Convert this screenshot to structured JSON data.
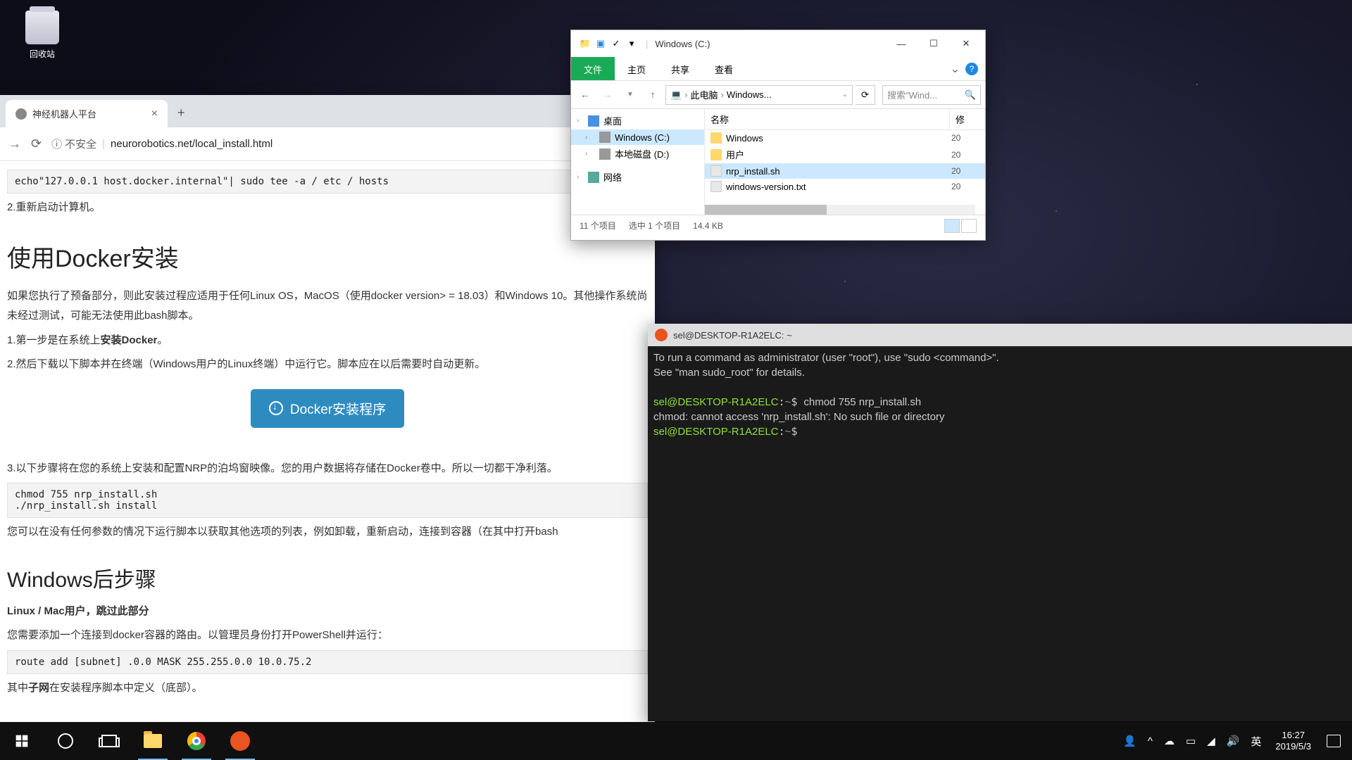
{
  "desktop": {
    "recycle_bin": "回收站"
  },
  "browser": {
    "tab_title": "神经机器人平台",
    "insecure": "不安全",
    "url": "neurorobotics.net/local_install.html",
    "code1": "echo\"127.0.0.1 host.docker.internal\"| sudo tee -a / etc / hosts",
    "step2": "2.重新启动计算机。",
    "h1": "使用Docker安装",
    "p1": "如果您执行了预备部分，则此安装过程应适用于任何Linux OS，MacOS（使用docker version> = 18.03）和Windows 10。其他操作系统尚未经过测试，可能无法使用此bash脚本。",
    "li1a": "1.第一步是在系统上",
    "li1b": "安装Docker",
    "li1c": "。",
    "li2": "2.然后下载以下脚本并在终端（Windows用户的Linux终端）中运行它。脚本应在以后需要时自动更新。",
    "docker_btn": "Docker安装程序",
    "li3": "3.以下步骤将在您的系统上安装和配置NRP的泊坞窗映像。您的用户数据将存储在Docker卷中。所以一切都干净利落。",
    "code2": "chmod 755 nrp_install.sh\n./nrp_install.sh install",
    "p2": "您可以在没有任何参数的情况下运行脚本以获取其他选项的列表，例如卸载，重新启动，连接到容器（在其中打开bash",
    "h2": "Windows后步骤",
    "p3": "Linux / Mac用户，跳过此部分",
    "p4": "您需要添加一个连接到docker容器的路由。以管理员身份打开PowerShell并运行：",
    "code3": "route add [subnet] .0.0 MASK 255.255.0.0 10.0.75.2",
    "p5a": "其中",
    "p5b": "子网",
    "p5c": "在安装程序脚本中定义（底部）。"
  },
  "explorer": {
    "title": "Windows (C:)",
    "tabs": {
      "file": "文件",
      "home": "主页",
      "share": "共享",
      "view": "查看"
    },
    "crumb": {
      "pc": "此电脑",
      "drive": "Windows..."
    },
    "search_ph": "搜索\"Wind...",
    "tree": {
      "desktop": "桌面",
      "c": "Windows (C:)",
      "d": "本地磁盘 (D:)",
      "network": "网络"
    },
    "cols": {
      "name": "名称",
      "mod": "修"
    },
    "rows": [
      {
        "name": "Windows",
        "date": "20",
        "type": "folder"
      },
      {
        "name": "用户",
        "date": "20",
        "type": "folder"
      },
      {
        "name": "nrp_install.sh",
        "date": "20",
        "type": "file",
        "selected": true
      },
      {
        "name": "windows-version.txt",
        "date": "20",
        "type": "file"
      }
    ],
    "status_items": "11 个项目",
    "status_sel": "选中 1 个项目",
    "status_size": "14.4 KB"
  },
  "terminal": {
    "title": "sel@DESKTOP-R1A2ELC: ~",
    "line1": "To run a command as administrator (user \"root\"), use \"sudo <command>\".",
    "line2": "See \"man sudo_root\" for details.",
    "user": "sel@DESKTOP-R1A2ELC",
    "path": "~",
    "cmd1": "chmod 755 nrp_install.sh",
    "err": "chmod: cannot access 'nrp_install.sh': No such file or directory"
  },
  "taskbar": {
    "ime": "英",
    "time": "16:27",
    "date": "2019/5/3"
  }
}
